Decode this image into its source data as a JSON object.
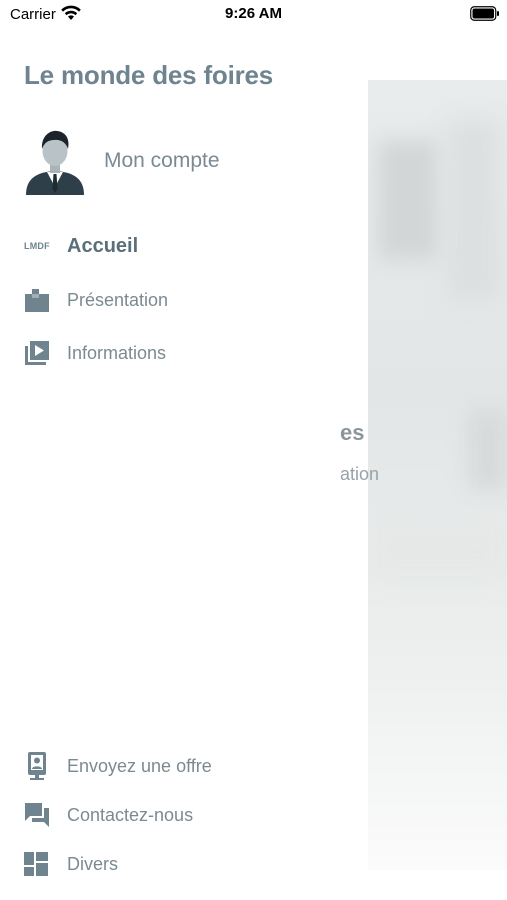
{
  "status_bar": {
    "carrier": "Carrier",
    "time": "9:26 AM",
    "wifi_icon": "wifi-icon",
    "battery_icon": "battery-icon"
  },
  "drawer": {
    "title": "Le monde des foires",
    "account": {
      "label": "Mon compte",
      "avatar_icon": "businessman-avatar"
    },
    "main_items": [
      {
        "label": "Accueil",
        "icon": "lmdf-logo-icon",
        "icon_text": "LMDF",
        "active": true
      },
      {
        "label": "Présentation",
        "icon": "folder-icon",
        "active": false
      },
      {
        "label": "Informations",
        "icon": "video-library-icon",
        "active": false
      }
    ],
    "bottom_items": [
      {
        "label": "Envoyez une offre",
        "icon": "contact-card-icon"
      },
      {
        "label": "Contactez-nous",
        "icon": "chat-bubbles-icon"
      },
      {
        "label": "Divers",
        "icon": "dashboard-icon"
      }
    ]
  },
  "background_page": {
    "title_fragment": "es",
    "subtitle_fragment": "ation"
  },
  "colors": {
    "primary": "#6f848f",
    "text": "#7b8a92",
    "active_text": "#5b6f7b"
  }
}
